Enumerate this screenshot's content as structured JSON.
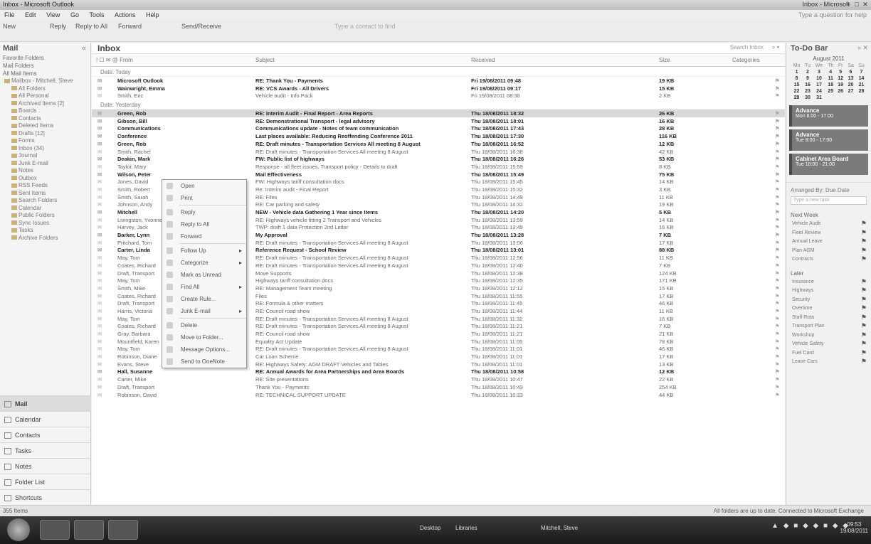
{
  "window": {
    "title": "Inbox - Microsoft Outlook",
    "right_text": "Inbox - Microsoft",
    "minimize": "–",
    "maximize": "□",
    "close": "✕"
  },
  "menu": {
    "items": [
      "File",
      "Edit",
      "View",
      "Go",
      "Tools",
      "Actions",
      "Help"
    ],
    "right": "Type a question for help"
  },
  "toolbar": {
    "new": "New",
    "reply": "Reply",
    "reply_all": "Reply to All",
    "forward": "Forward",
    "send_receive": "Send/Receive",
    "search_placeholder": "Type a contact to find"
  },
  "nav": {
    "header": "Mail",
    "favorites_label": "Favorite Folders",
    "mail_folders_label": "Mail Folders",
    "all_items": "All Mail Items",
    "folders": [
      "Mailbox - Mitchell, Steve",
      "All Folders",
      "All Personal",
      "Archived Items [2]",
      "Boards",
      "Contacts",
      "Deleted Items",
      "Drafts [12]",
      "Forms",
      "Inbox (34)",
      "Journal",
      "Junk E-mail",
      "Notes",
      "Outbox",
      "RSS Feeds",
      "Sent Items",
      "Search Folders",
      "Calendar",
      "Public Folders",
      "Sync Issues",
      "Tasks",
      "Archive Folders"
    ],
    "buttons": [
      "Mail",
      "Calendar",
      "Contacts",
      "Tasks",
      "Notes",
      "Folder List",
      "Shortcuts"
    ]
  },
  "inbox": {
    "title": "Inbox",
    "search_placeholder": "Search Inbox",
    "columns": {
      "icons": "! ☐ ✉ @ From",
      "subject": "Subject",
      "received": "Received",
      "size": "Size",
      "categories": "Categories"
    },
    "groups": {
      "today": "Date: Today",
      "yesterday": "Date: Yesterday"
    },
    "today_rows": [
      {
        "from": "Microsoft Outlook",
        "subject": "RE: Thank You - Payments",
        "received": "Fri 19/08/2011 09:48",
        "size": "19 KB",
        "unread": true
      },
      {
        "from": "Wainwright, Emma",
        "subject": "RE: VCS Awards - All Drivers",
        "received": "Fri 19/08/2011 09:17",
        "size": "15 KB",
        "unread": true
      },
      {
        "from": "Smith, Eric",
        "subject": "Vehicle audit - Info Pack",
        "received": "Fri 19/08/2011 08:38",
        "size": "2 KB",
        "unread": false
      }
    ],
    "yesterday_rows": [
      {
        "from": "Green, Rob",
        "subject": "RE: Interim Audit - Final Report - Area Reports",
        "received": "Thu 18/08/2011 18:32",
        "size": "26 KB",
        "unread": true,
        "selected": true
      },
      {
        "from": "Gibson, Bill",
        "subject": "RE: Demonstrational Transport - legal advisory",
        "received": "Thu 18/08/2011 18:01",
        "size": "16 KB",
        "unread": true
      },
      {
        "from": "Communications",
        "subject": "Communications update - Notes of team communication",
        "received": "Thu 18/08/2011 17:43",
        "size": "28 KB",
        "unread": true
      },
      {
        "from": "Conference",
        "subject": "Last places available: Reducing Reoffending Conference 2011",
        "received": "Thu 18/08/2011 17:30",
        "size": "116 KB",
        "unread": true
      },
      {
        "from": "Green, Rob",
        "subject": "RE: Draft minutes - Transportation Services All meeting 8 August",
        "received": "Thu 18/08/2011 16:52",
        "size": "12 KB",
        "unread": true
      },
      {
        "from": "Smith, Rachel",
        "subject": "RE: Draft minutes - Transportation Services All meeting 8 August",
        "received": "Thu 18/08/2011 16:38",
        "size": "42 KB",
        "unread": false
      },
      {
        "from": "Deakin, Mark",
        "subject": "FW: Public list of highways",
        "received": "Thu 18/08/2011 16:26",
        "size": "53 KB",
        "unread": true
      },
      {
        "from": "Taylor, Mary",
        "subject": "Response - all fleet issues, Transport policy - Details to draft",
        "received": "Thu 18/08/2011 15:59",
        "size": "8 KB",
        "unread": false
      },
      {
        "from": "Wilson, Peter",
        "subject": "Mail Effectiveness",
        "received": "Thu 18/08/2011 15:49",
        "size": "75 KB",
        "unread": true
      },
      {
        "from": "Jones, David",
        "subject": "FW: Highways tariff consultation docs",
        "received": "Thu 18/08/2011 15:45",
        "size": "14 KB",
        "unread": false
      },
      {
        "from": "Smith, Robert",
        "subject": "Re: Interim audit - Final Report",
        "received": "Thu 18/08/2011 15:32",
        "size": "3 KB",
        "unread": false
      },
      {
        "from": "Smith, Sarah",
        "subject": "RE: Files",
        "received": "Thu 18/08/2011 14:49",
        "size": "11 KB",
        "unread": false
      },
      {
        "from": "Johnson, Andy",
        "subject": "RE: Car parking and safety",
        "received": "Thu 18/08/2011 14:32",
        "size": "19 KB",
        "unread": false
      },
      {
        "from": "Mitchell",
        "subject": "NEW - Vehicle data Gathering 1 Year since Items",
        "received": "Thu 18/08/2011 14:20",
        "size": "5 KB",
        "unread": true
      },
      {
        "from": "Livingston, Yvonne",
        "subject": "RE: Highways vehicle fitting 2 Transport and Vehicles",
        "received": "Thu 18/08/2011 13:59",
        "size": "14 KB",
        "unread": false
      },
      {
        "from": "Harvey, Jack",
        "subject": "TWP: draft 1 data Protection 2nd Letter",
        "received": "Thu 18/08/2011 13:49",
        "size": "16 KB",
        "unread": false
      },
      {
        "from": "Barker, Lynn",
        "subject": "My Approval",
        "received": "Thu 18/08/2011 13:28",
        "size": "7 KB",
        "unread": true
      },
      {
        "from": "Pritchard, Tom",
        "subject": "RE: Draft minutes - Transportation Services All meeting 8 August",
        "received": "Thu 18/08/2011 13:06",
        "size": "17 KB",
        "unread": false
      },
      {
        "from": "Carter, Linda",
        "subject": "Reference Request - School Review",
        "received": "Thu 18/08/2011 13:01",
        "size": "88 KB",
        "unread": true
      },
      {
        "from": "May, Tom",
        "subject": "RE: Draft minutes - Transportation Services All meeting 8 August",
        "received": "Thu 18/08/2011 12:56",
        "size": "11 KB",
        "unread": false
      },
      {
        "from": "Coates, Richard",
        "subject": "RE: Draft minutes - Transportation Services All meeting 8 August",
        "received": "Thu 18/08/2011 12:40",
        "size": "7 KB",
        "unread": false
      },
      {
        "from": "Draft, Transport",
        "subject": "Move Supports",
        "received": "Thu 18/08/2011 12:38",
        "size": "124 KB",
        "unread": false
      },
      {
        "from": "May, Tom",
        "subject": "Highways tariff consultation docs",
        "received": "Thu 18/08/2011 12:35",
        "size": "171 KB",
        "unread": false
      },
      {
        "from": "Smith, Mike",
        "subject": "RE: Management Team meeting",
        "received": "Thu 18/08/2011 12:12",
        "size": "15 KB",
        "unread": false
      },
      {
        "from": "Coates, Richard",
        "subject": "Files",
        "received": "Thu 18/08/2011 11:55",
        "size": "17 KB",
        "unread": false
      },
      {
        "from": "Draft, Transport",
        "subject": "RE: Formula & other matters",
        "received": "Thu 18/08/2011 11:45",
        "size": "46 KB",
        "unread": false
      },
      {
        "from": "Harris, Victoria",
        "subject": "RE: Council road show",
        "received": "Thu 18/08/2011 11:44",
        "size": "11 KB",
        "unread": false
      },
      {
        "from": "May, Tom",
        "subject": "RE: Draft minutes - Transportation Services All meeting 8 August",
        "received": "Thu 18/08/2011 11:32",
        "size": "16 KB",
        "unread": false
      },
      {
        "from": "Coates, Richard",
        "subject": "RE: Draft minutes - Transportation Services All meeting 8 August",
        "received": "Thu 18/08/2011 11:21",
        "size": "7 KB",
        "unread": false
      },
      {
        "from": "Gray, Barbara",
        "subject": "RE: Council road show",
        "received": "Thu 18/08/2011 11:21",
        "size": "21 KB",
        "unread": false
      },
      {
        "from": "Mountfield, Karen",
        "subject": "Equality Act Update",
        "received": "Thu 18/08/2011 11:05",
        "size": "78 KB",
        "unread": false
      },
      {
        "from": "May, Tom",
        "subject": "RE: Draft minutes - Transportation Services All meeting 8 August",
        "received": "Thu 18/08/2011 11:01",
        "size": "46 KB",
        "unread": false
      },
      {
        "from": "Robinson, Diane",
        "subject": "Car Loan Scheme",
        "received": "Thu 18/08/2011 11:01",
        "size": "17 KB",
        "unread": false
      },
      {
        "from": "Evans, Steve",
        "subject": "RE: Highways Safety: AGM DRAFT Vehicles and Tables",
        "received": "Thu 18/08/2011 11:01",
        "size": "13 KB",
        "unread": false
      },
      {
        "from": "Hall, Susanne",
        "subject": "RE: Annual Awards for Area Partnerships and Area Boards",
        "received": "Thu 18/08/2011 10:58",
        "size": "12 KB",
        "unread": true
      },
      {
        "from": "Carter, Mike",
        "subject": "RE: Site presentations",
        "received": "Thu 18/08/2011 10:47",
        "size": "22 KB",
        "unread": false
      },
      {
        "from": "Draft, Transport",
        "subject": "Thank You - Payments",
        "received": "Thu 18/08/2011 10:43",
        "size": "254 KB",
        "unread": false
      },
      {
        "from": "Robinson, David",
        "subject": "RE: TECHNICAL SUPPORT UPDATE",
        "received": "Thu 18/08/2011 10:33",
        "size": "44 KB",
        "unread": false
      }
    ]
  },
  "context_menu": {
    "items": [
      {
        "label": "Open",
        "submenu": false
      },
      {
        "label": "Print",
        "submenu": false
      },
      {
        "label": "sep"
      },
      {
        "label": "Reply",
        "submenu": false
      },
      {
        "label": "Reply to All",
        "submenu": false
      },
      {
        "label": "Forward",
        "submenu": false
      },
      {
        "label": "sep"
      },
      {
        "label": "Follow Up",
        "submenu": true
      },
      {
        "label": "Categorize",
        "submenu": true
      },
      {
        "label": "Mark as Unread",
        "submenu": false
      },
      {
        "label": "Find All",
        "submenu": true
      },
      {
        "label": "Create Rule...",
        "submenu": false
      },
      {
        "label": "Junk E-mail",
        "submenu": true
      },
      {
        "label": "sep"
      },
      {
        "label": "Delete",
        "submenu": false
      },
      {
        "label": "Move to Folder...",
        "submenu": false
      },
      {
        "label": "Message Options...",
        "submenu": false
      },
      {
        "label": "Send to OneNote",
        "submenu": false
      }
    ]
  },
  "todo": {
    "header": "To-Do Bar",
    "calendar": {
      "month": "August 2011",
      "dow": [
        "Mo",
        "Tu",
        "We",
        "Th",
        "Fr",
        "Sa",
        "Su"
      ],
      "weeks": [
        [
          "1",
          "2",
          "3",
          "4",
          "5",
          "6",
          "7"
        ],
        [
          "8",
          "9",
          "10",
          "11",
          "12",
          "13",
          "14"
        ],
        [
          "15",
          "16",
          "17",
          "18",
          "19",
          "20",
          "21"
        ],
        [
          "22",
          "23",
          "24",
          "25",
          "26",
          "27",
          "28"
        ],
        [
          "29",
          "30",
          "31",
          "",
          "",
          "",
          ""
        ]
      ]
    },
    "appointments": [
      {
        "title": "Advance",
        "time": "Mon 8:00 - 17:00"
      },
      {
        "title": "Advance",
        "time": "Tue 8:00 - 17:00"
      },
      {
        "title": "Cabinet Area Board",
        "time": "Tue 18:00 - 21:00"
      }
    ],
    "arranged_by": "Arranged By: Due Date",
    "new_task": "Type a new task",
    "task_sections": [
      {
        "label": "Next Week",
        "tasks": [
          "Vehicle Audit",
          "Fleet Review",
          "Annual Leave",
          "Plan AGM",
          "Contracts"
        ]
      },
      {
        "label": "Later",
        "tasks": [
          "Insurance",
          "Highways",
          "Security",
          "Overtime",
          "Staff Rota",
          "Transport Plan",
          "Workshop",
          "Vehicle Safety",
          "Fuel Card",
          "Lease Cars"
        ]
      }
    ]
  },
  "status": {
    "left": "355 Items",
    "right": "All folders are up to date.   Connected to Microsoft Exchange"
  },
  "taskbar": {
    "items": [
      "Desktop",
      "Libraries",
      "Mitchell, Steve"
    ],
    "tray": "▲ ◆ ■ ◆ ◆ ■ ◆ ◆",
    "time": "09:53",
    "date": "19/08/2011"
  }
}
